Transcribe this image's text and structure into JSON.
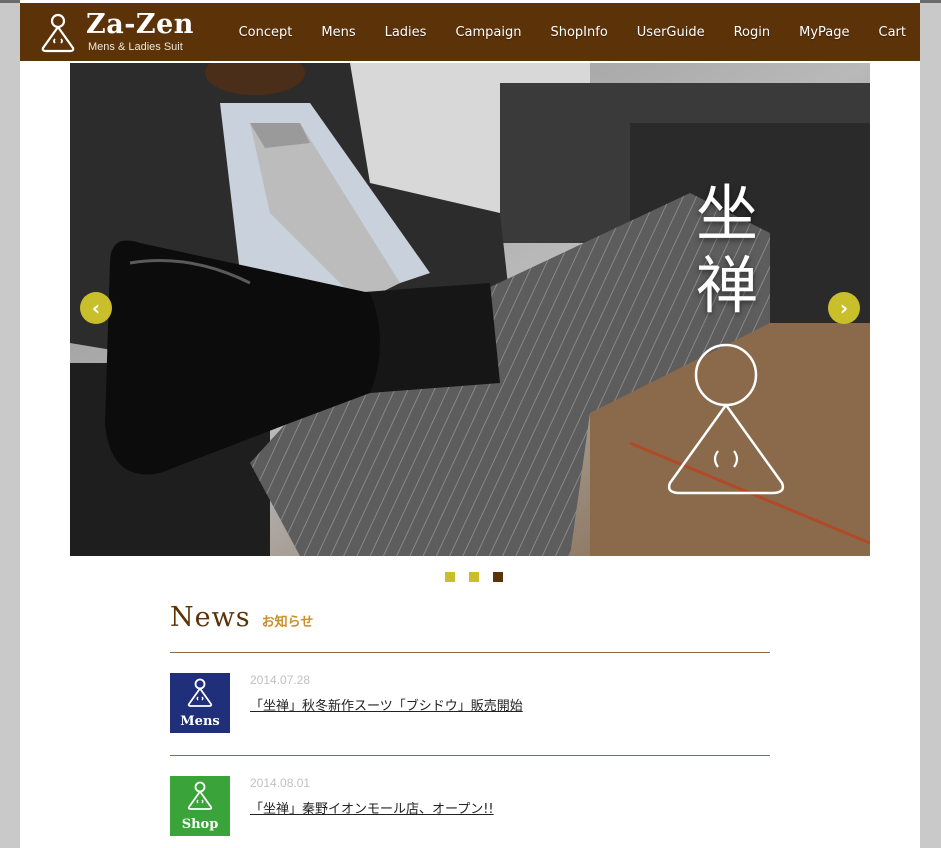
{
  "header": {
    "logo_title": "Za-Zen",
    "logo_subtitle": "Mens & Ladies Suit",
    "nav": [
      "Concept",
      "Mens",
      "Ladies",
      "Campaign",
      "ShopInfo",
      "UserGuide",
      "Rogin",
      "MyPage",
      "Cart"
    ]
  },
  "hero": {
    "kanji_1": "坐",
    "kanji_2": "禅",
    "prev_label": "‹",
    "next_label": "›",
    "slide_count": 3,
    "active_slide": 3
  },
  "news": {
    "title": "News",
    "subtitle": "お知らせ",
    "items": [
      {
        "category": "Mens",
        "category_color": "#1f2f7a",
        "date": "2014.07.28",
        "text": "「坐禅」秋冬新作スーツ「ブシドウ」販売開始"
      },
      {
        "category": "Shop",
        "category_color": "#3aa33a",
        "date": "2014.08.01",
        "text": "「坐禅」秦野イオンモール店、オープン!!"
      }
    ]
  },
  "colors": {
    "brand_brown": "#5c3209",
    "accent_olive": "#c8bf2a",
    "news_subtitle": "#c8902a"
  }
}
